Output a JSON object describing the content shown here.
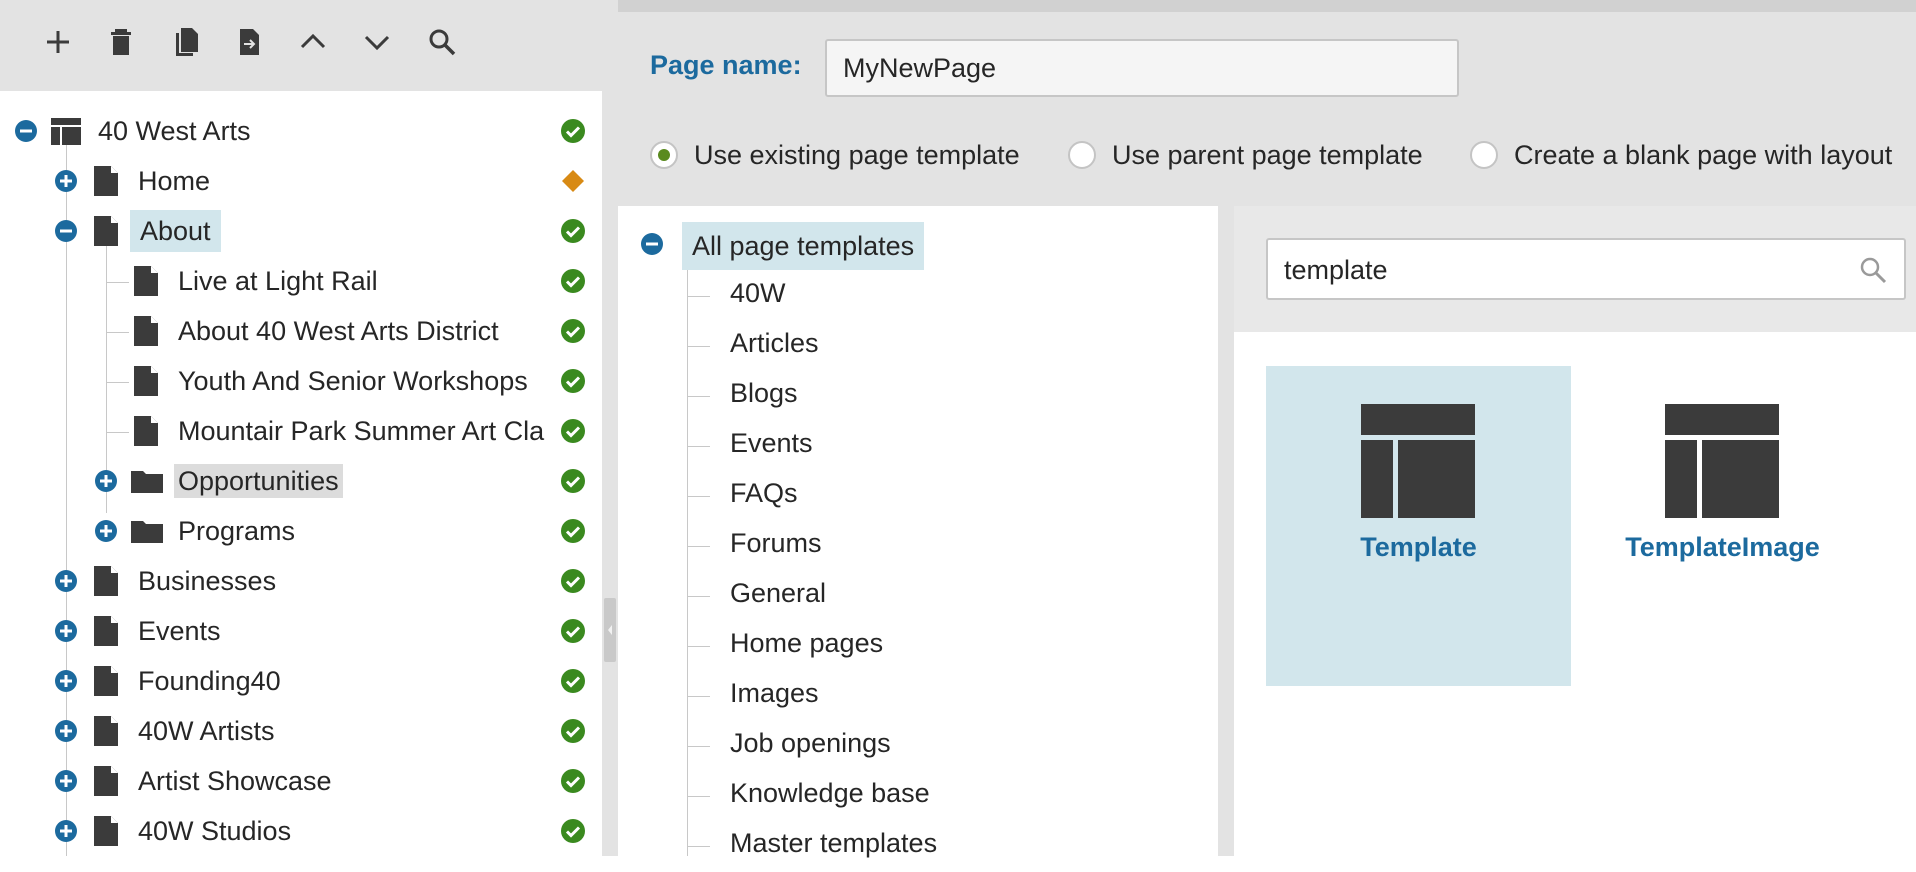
{
  "toolbar": {
    "buttons": [
      "new",
      "delete",
      "copy",
      "move",
      "move-up",
      "move-down",
      "search"
    ]
  },
  "tree": {
    "items": [
      {
        "label": "40 West Arts",
        "status": "published"
      },
      {
        "label": "Home",
        "status": "modified"
      },
      {
        "label": "About",
        "status": "published"
      },
      {
        "label": "Live at Light Rail",
        "status": "published"
      },
      {
        "label": "About 40 West Arts District",
        "status": "published"
      },
      {
        "label": "Youth And Senior Workshops",
        "status": "published"
      },
      {
        "label": "Mountair Park Summer Art Clа",
        "status": "published"
      },
      {
        "label": "Opportunities",
        "status": "published"
      },
      {
        "label": "Programs",
        "status": "published"
      },
      {
        "label": "Businesses",
        "status": "published"
      },
      {
        "label": "Events",
        "status": "published"
      },
      {
        "label": "Founding40",
        "status": "published"
      },
      {
        "label": "40W Artists",
        "status": "published"
      },
      {
        "label": "Artist Showcase",
        "status": "published"
      },
      {
        "label": "40W Studios",
        "status": "published"
      }
    ]
  },
  "dialog": {
    "page_name_label": "Page name:",
    "page_name_value": "MyNewPage",
    "radio_options": [
      {
        "label": "Use existing page template",
        "checked": true
      },
      {
        "label": "Use parent page template",
        "checked": false
      },
      {
        "label": "Create a blank page with layout",
        "checked": false
      }
    ],
    "categories": {
      "root": "All page templates",
      "items": [
        "40W",
        "Articles",
        "Blogs",
        "Events",
        "FAQs",
        "Forums",
        "General",
        "Home pages",
        "Images",
        "Job openings",
        "Knowledge base",
        "Master templates"
      ]
    },
    "search": {
      "value": "template"
    },
    "templates": [
      {
        "name": "Template",
        "selected": true
      },
      {
        "name": "TemplateImage",
        "selected": false
      }
    ]
  },
  "colors": {
    "accent_blue": "#1c6a9e",
    "status_green": "#3a8a1f",
    "status_orange": "#d88a14",
    "selection_bg": "#d2e6ec"
  }
}
